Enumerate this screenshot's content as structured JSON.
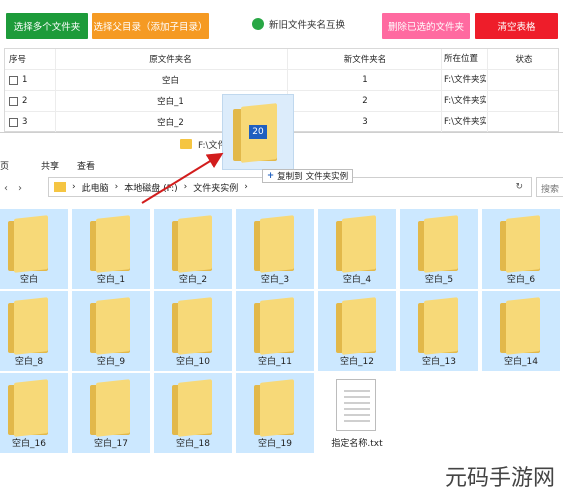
{
  "toolbar": {
    "select_multiple": "选择多个文件夹",
    "select_parent": "选择父目录（添加子目录）",
    "swap_names": "新旧文件夹名互换",
    "remove_selected": "删除已选的文件夹",
    "clear_table": "清空表格"
  },
  "table": {
    "headers": [
      "序号",
      "原文件夹名",
      "新文件夹名",
      "所在位置",
      "状态"
    ],
    "rows": [
      {
        "no": "1",
        "orig": "空白",
        "new": "1",
        "loc": "F:\\文件夹实例",
        "status": ""
      },
      {
        "no": "2",
        "orig": "空白_1",
        "new": "2",
        "loc": "F:\\文件夹实例",
        "status": ""
      },
      {
        "no": "3",
        "orig": "空白_2",
        "new": "3",
        "loc": "F:\\文件夹实例",
        "status": ""
      }
    ]
  },
  "explorer": {
    "title": "F:\\文件夹实例",
    "ribbon": [
      "页",
      "共享",
      "查看"
    ],
    "breadcrumb": [
      "此电脑",
      "本地磁盘 (F:)",
      "文件夹实例"
    ],
    "search_placeholder": "搜索",
    "items": [
      "空白",
      "空白_1",
      "空白_2",
      "空白_3",
      "空白_4",
      "空白_5",
      "空白_6",
      "空白_8",
      "空白_9",
      "空白_10",
      "空白_11",
      "空白_12",
      "空白_13",
      "空白_14",
      "空白_16",
      "空白_17",
      "空白_18",
      "空白_19",
      "指定名称.txt"
    ]
  },
  "drag": {
    "count": "20",
    "hint_action": "复制到",
    "hint_target": "文件夹实例"
  },
  "watermark": "元码手游网"
}
